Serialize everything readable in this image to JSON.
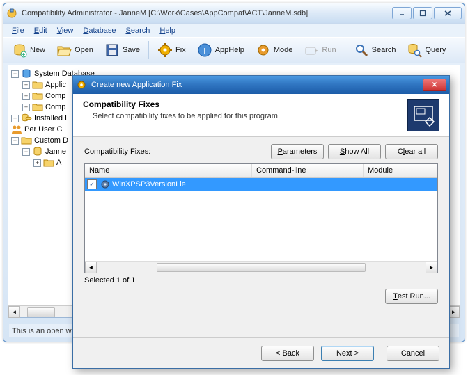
{
  "window": {
    "title": "Compatibility Administrator - JanneM [C:\\Work\\Cases\\AppCompat\\ACT\\JanneM.sdb]"
  },
  "menu": {
    "file": "File",
    "edit": "Edit",
    "view": "View",
    "database": "Database",
    "search": "Search",
    "help": "Help"
  },
  "toolbar": {
    "new": "New",
    "open": "Open",
    "save": "Save",
    "fix": "Fix",
    "apphelp": "AppHelp",
    "mode": "Mode",
    "run": "Run",
    "search": "Search",
    "query": "Query"
  },
  "tree": {
    "system_db": "System Database",
    "applications": "Applic",
    "comp_fixes": "Comp",
    "comp_modes": "Comp",
    "installed": "Installed I",
    "per_user": "Per User C",
    "custom": "Custom D",
    "janne": "Janne",
    "app_node": "A"
  },
  "statusbar": {
    "text": "This is an open w"
  },
  "dialog": {
    "title": "Create new Application Fix",
    "heading": "Compatibility Fixes",
    "sub": "Select compatibility fixes to be applied for this program.",
    "fixes_label": "Compatibility Fixes:",
    "parameters": "Parameters",
    "show_all": "Show All",
    "clear_all": "Clear all",
    "cols": {
      "name": "Name",
      "cmdline": "Command-line",
      "module": "Module"
    },
    "row0": {
      "name": "WinXPSP3VersionLie",
      "checked": true
    },
    "selected": "Selected 1 of 1",
    "test_run": "Test Run...",
    "back": "< Back",
    "next": "Next >",
    "cancel": "Cancel"
  }
}
